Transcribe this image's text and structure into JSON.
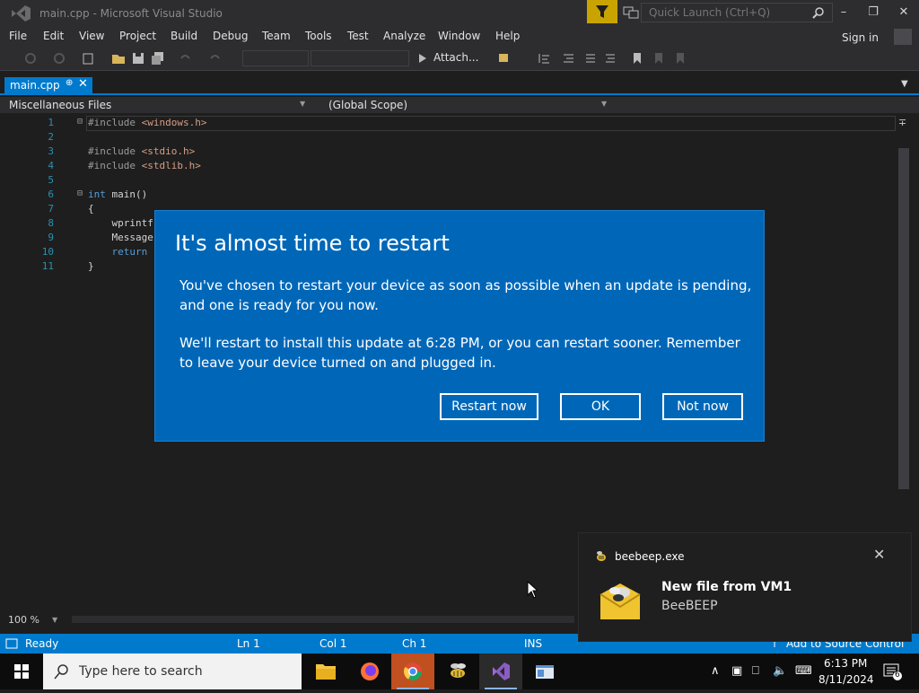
{
  "window": {
    "title": "main.cpp - Microsoft Visual Studio",
    "quick_launch_placeholder": "Quick Launch (Ctrl+Q)",
    "sign_in": "Sign in"
  },
  "menu": [
    "File",
    "Edit",
    "View",
    "Project",
    "Build",
    "Debug",
    "Team",
    "Tools",
    "Test",
    "Analyze",
    "Window",
    "Help"
  ],
  "toolbar": {
    "attach_label": "Attach..."
  },
  "tabs": [
    {
      "label": "main.cpp",
      "active": true
    }
  ],
  "navbar": {
    "project": "Miscellaneous Files",
    "scope": "(Global Scope)"
  },
  "editor": {
    "line_numbers": [
      "1",
      "2",
      "3",
      "4",
      "5",
      "6",
      "7",
      "8",
      "9",
      "10",
      "11"
    ],
    "zoom": "100 %"
  },
  "statusbar": {
    "ready": "Ready",
    "ln": "Ln 1",
    "col": "Col 1",
    "ch": "Ch 1",
    "ins": "INS",
    "source_control": "Add to Source Control"
  },
  "dialog": {
    "title": "It's almost time to restart",
    "para1": "You've chosen to restart your device as soon as possible when an update is pending, and one is ready for you now.",
    "para2": "We'll restart to install this update at 6:28 PM, or you can restart sooner. Remember to leave your device turned on and plugged in.",
    "buttons": {
      "restart_now": "Restart now",
      "ok": "OK",
      "not_now": "Not now"
    }
  },
  "toast": {
    "app": "beebeep.exe",
    "title": "New file from VM1",
    "body": "BeeBEEP"
  },
  "taskbar": {
    "search_placeholder": "Type here to search",
    "time": "6:13 PM",
    "date": "8/11/2024",
    "notification_count": "6"
  },
  "colors": {
    "vs_accent": "#007acc",
    "dialog_bg": "#0067b8",
    "filter_yellow": "#c9a400"
  }
}
